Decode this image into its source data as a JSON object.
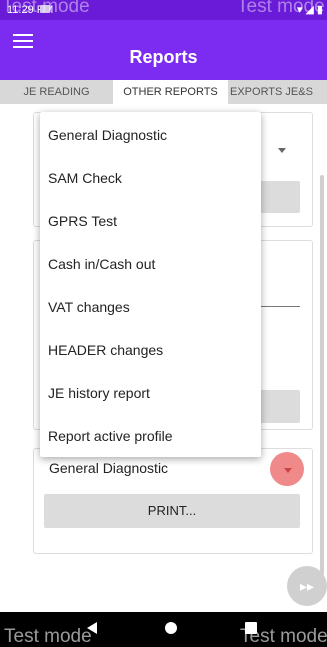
{
  "status_bar": {
    "time": "11:29 PM",
    "sys_icons": "▾ ◢ ▮"
  },
  "watermark": {
    "text": "Test mode"
  },
  "app_bar": {
    "title": "Reports"
  },
  "tabs": [
    {
      "label": "JE READING"
    },
    {
      "label": "OTHER REPORTS"
    },
    {
      "label": "EXPORTS JE&S"
    }
  ],
  "dropdown_menu": {
    "items": [
      {
        "label": "General Diagnostic"
      },
      {
        "label": "SAM Check"
      },
      {
        "label": "GPRS Test"
      },
      {
        "label": "Cash in/Cash out"
      },
      {
        "label": "VAT changes"
      },
      {
        "label": "HEADER changes"
      },
      {
        "label": "JE history report"
      },
      {
        "label": "Report active profile"
      }
    ]
  },
  "report_card": {
    "selected_value": "General Diagnostic",
    "print_label": "PRINT..."
  },
  "fab": {
    "icon": "fast-forward-icon",
    "glyph": "▸▸"
  },
  "colors": {
    "status_bar": "#6a1bd8",
    "app_bar": "#7b2cf0",
    "accent": "#f08a8a"
  }
}
